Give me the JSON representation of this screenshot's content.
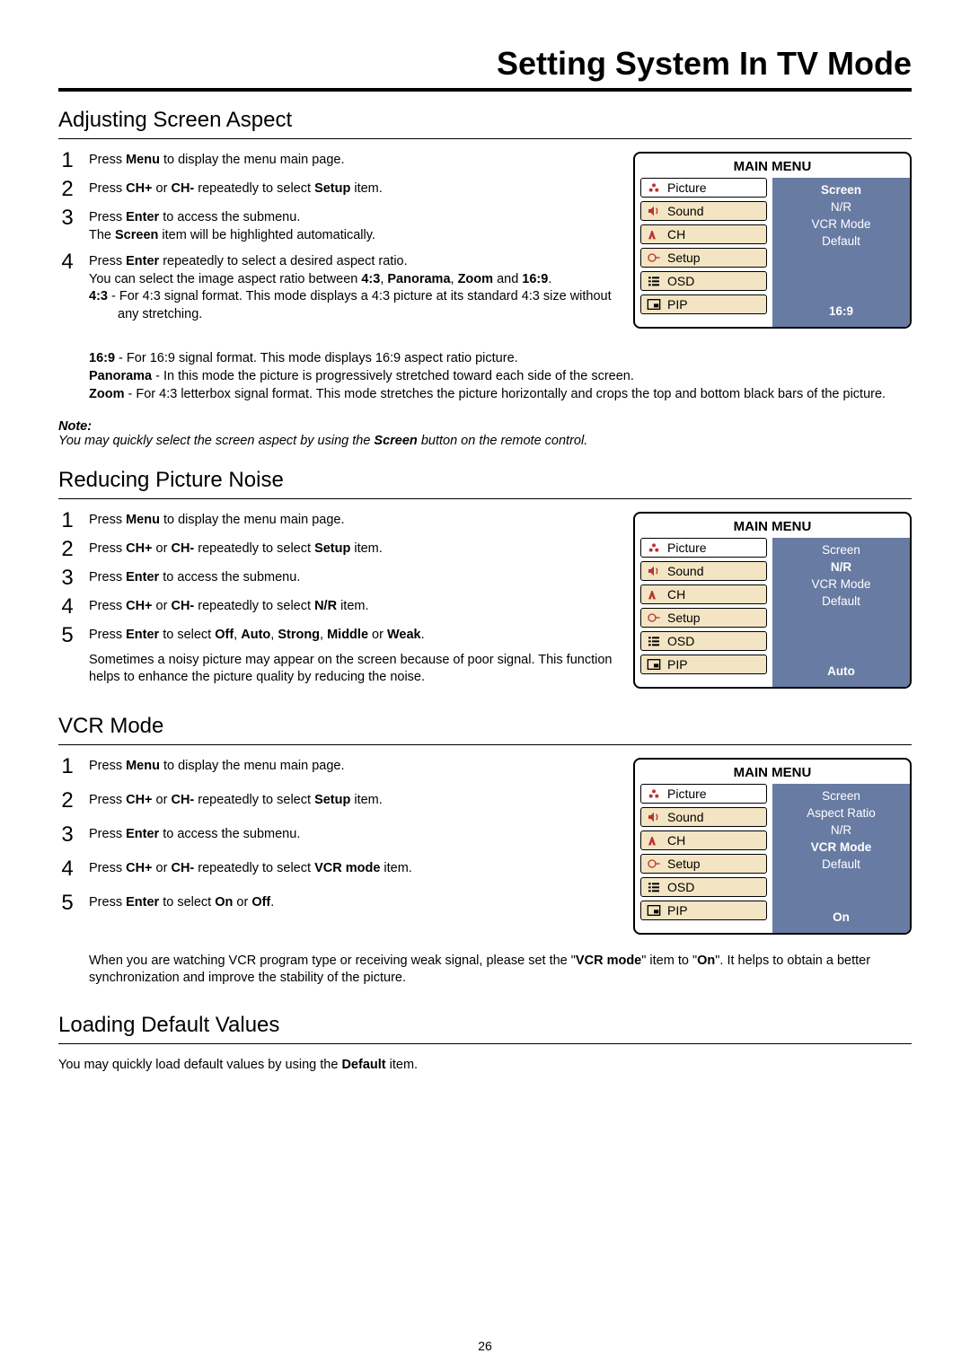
{
  "pageTitle": "Setting System In TV Mode",
  "pageNumber": "26",
  "menuHeader": "MAIN MENU",
  "menuLeft": {
    "picture": "Picture",
    "sound": "Sound",
    "ch": "CH",
    "setup": "Setup",
    "osd": "OSD",
    "pip": "PIP"
  },
  "section1": {
    "title": "Adjusting Screen Aspect",
    "step1_a": "Press ",
    "step1_b": "Menu",
    "step1_c": " to display the menu main page.",
    "step2_a": "Press ",
    "step2_b": "CH+",
    "step2_c": " or ",
    "step2_d": "CH-",
    "step2_e": " repeatedly to select ",
    "step2_f": "Setup",
    "step2_g": " item.",
    "step3_a": "Press ",
    "step3_b": "Enter",
    "step3_c": " to access the submenu.",
    "step3_sub_a": "The ",
    "step3_sub_b": "Screen",
    "step3_sub_c": " item will be highlighted automatically.",
    "step4_a": "Press ",
    "step4_b": "Enter",
    "step4_c": " repeatedly to select a desired aspect ratio.",
    "step4_sub_a": "You can select the image aspect ratio between ",
    "step4_sub_b": "4:3",
    "step4_sub_c": ", ",
    "step4_sub_d": "Panorama",
    "step4_sub_e": ", ",
    "step4_sub_f": "Zoom",
    "step4_sub_g": " and ",
    "step4_sub_h": "16:9",
    "step4_sub_i": ".",
    "aspect1_a": "4:3",
    "aspect1_b": " - For 4:3 signal format. This mode displays a 4:3 picture at its standard 4:3 size without any stretching.",
    "aspect2_a": "16:9",
    "aspect2_b": " - For 16:9 signal format. This mode displays 16:9 aspect ratio picture.",
    "aspect3_a": "Panorama",
    "aspect3_b": " - In this mode the picture is progressively stretched toward each side of the screen.",
    "aspect4_a": "Zoom",
    "aspect4_b": " - For 4:3 letterbox signal format. This mode stretches the picture horizontally and crops the top and bottom black bars of the picture.",
    "noteHead": "Note:",
    "noteBody_a": "You may quickly select the screen aspect by using the ",
    "noteBody_b": "Screen",
    "noteBody_c": " button on the remote control.",
    "menuRight": {
      "i1": "Screen",
      "i2": "N/R",
      "i3": "VCR Mode",
      "i4": "Default",
      "val": "16:9"
    }
  },
  "section2": {
    "title": "Reducing Picture Noise",
    "step1_a": "Press ",
    "step1_b": "Menu",
    "step1_c": " to display the menu main page.",
    "step2_a": "Press ",
    "step2_b": "CH+",
    "step2_c": " or ",
    "step2_d": "CH-",
    "step2_e": " repeatedly to select ",
    "step2_f": "Setup",
    "step2_g": " item.",
    "step3_a": "Press ",
    "step3_b": "Enter",
    "step3_c": " to access the submenu.",
    "step4_a": "Press ",
    "step4_b": "CH+",
    "step4_c": " or ",
    "step4_d": "CH-",
    "step4_e": " repeatedly to select ",
    "step4_f": "N/R",
    "step4_g": " item.",
    "step5_a": "Press ",
    "step5_b": "Enter",
    "step5_c": " to select ",
    "step5_d": "Off",
    "step5_e": ", ",
    "step5_f": "Auto",
    "step5_g": ", ",
    "step5_h": "Strong",
    "step5_i": ", ",
    "step5_j": "Middle",
    "step5_k": " or ",
    "step5_l": "Weak",
    "step5_m": ".",
    "step5_body": "Sometimes a noisy picture may appear on the screen because of poor signal. This function helps to enhance the picture quality by reducing the noise.",
    "menuRight": {
      "i1": "Screen",
      "i2": "N/R",
      "i3": "VCR Mode",
      "i4": "Default",
      "val": "Auto"
    }
  },
  "section3": {
    "title": "VCR Mode",
    "step1_a": "Press ",
    "step1_b": "Menu",
    "step1_c": " to display the menu main page.",
    "step2_a": "Press ",
    "step2_b": "CH+",
    "step2_c": " or ",
    "step2_d": "CH-",
    "step2_e": " repeatedly to select ",
    "step2_f": "Setup",
    "step2_g": " item.",
    "step3_a": "Press ",
    "step3_b": "Enter",
    "step3_c": " to access the submenu.",
    "step4_a": "Press ",
    "step4_b": "CH+",
    "step4_c": " or ",
    "step4_d": "CH-",
    "step4_e": " repeatedly to select ",
    "step4_f": "VCR mode",
    "step4_g": " item.",
    "step5_a": "Press ",
    "step5_b": "Enter",
    "step5_c": " to select ",
    "step5_d": "On",
    "step5_e": " or ",
    "step5_f": "Off",
    "step5_g": ".",
    "followup_a": "When you are watching VCR program type or receiving weak signal, please set the \"",
    "followup_b": "VCR mode",
    "followup_c": "\" item to \"",
    "followup_d": "On",
    "followup_e": "\". It helps to obtain a better synchronization and improve the stability of the picture.",
    "menuRight": {
      "i1": "Screen",
      "i2": "Aspect Ratio",
      "i3": "N/R",
      "i4": "VCR Mode",
      "i5": "Default",
      "val": "On"
    }
  },
  "section4": {
    "title": "Loading Default Values",
    "body_a": "You may quickly load default values by using the ",
    "body_b": "Default",
    "body_c": " item."
  }
}
